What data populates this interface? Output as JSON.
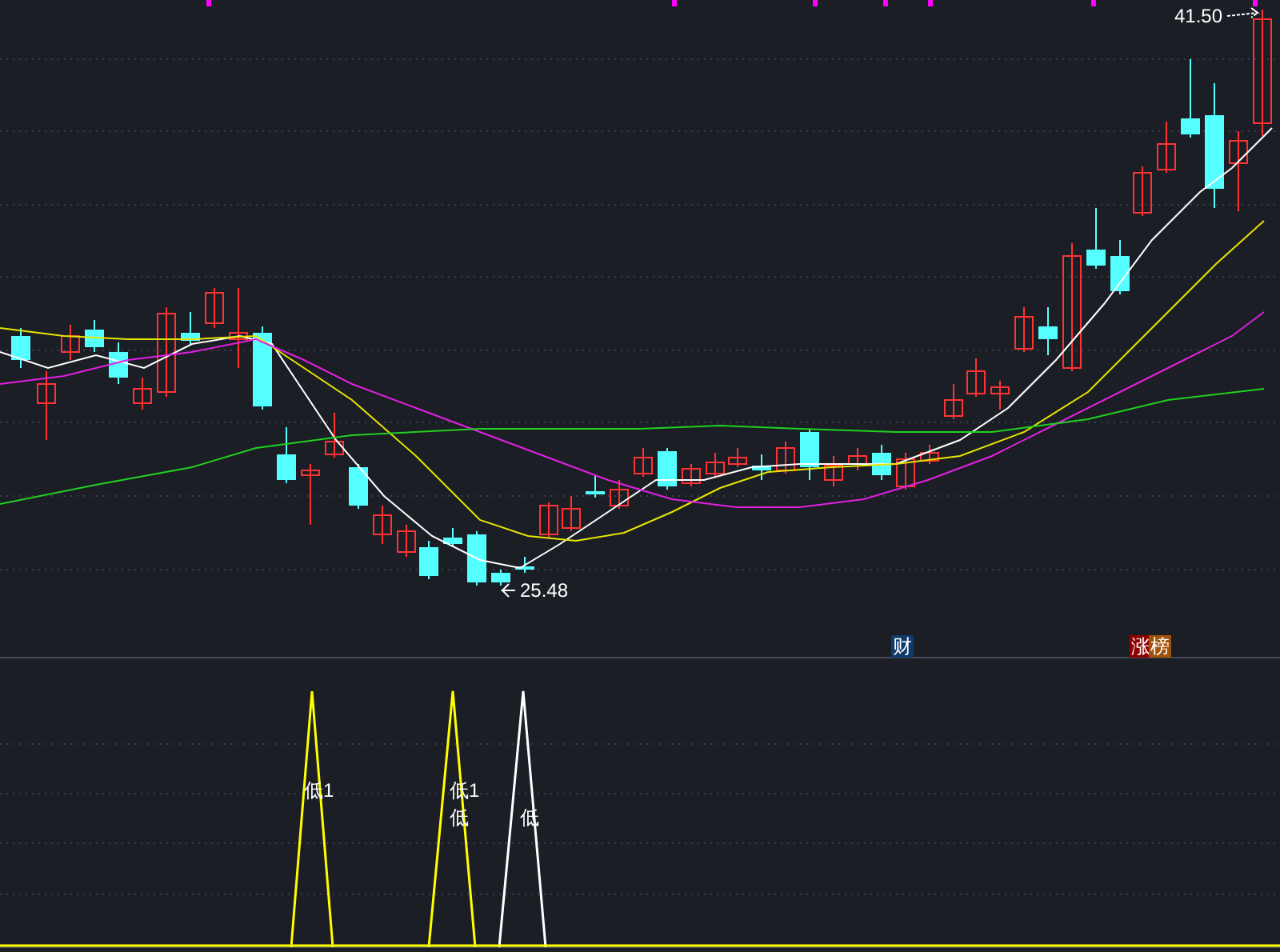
{
  "price_chart": {
    "high_label": "41.50",
    "low_label": "25.48"
  },
  "event_tags": [
    {
      "text": "财",
      "color": "#0e3a6b"
    },
    {
      "text": "涨",
      "color": "#8b0000"
    },
    {
      "text": "榜",
      "color": "#a0520a"
    }
  ],
  "indicator": {
    "labels": [
      {
        "text": "低1",
        "color": "#ffffff"
      },
      {
        "text": "低1",
        "color": "#ffffff"
      },
      {
        "text": "低",
        "color": "#ffffff"
      },
      {
        "text": "低",
        "color": "#ffffff"
      }
    ]
  }
}
